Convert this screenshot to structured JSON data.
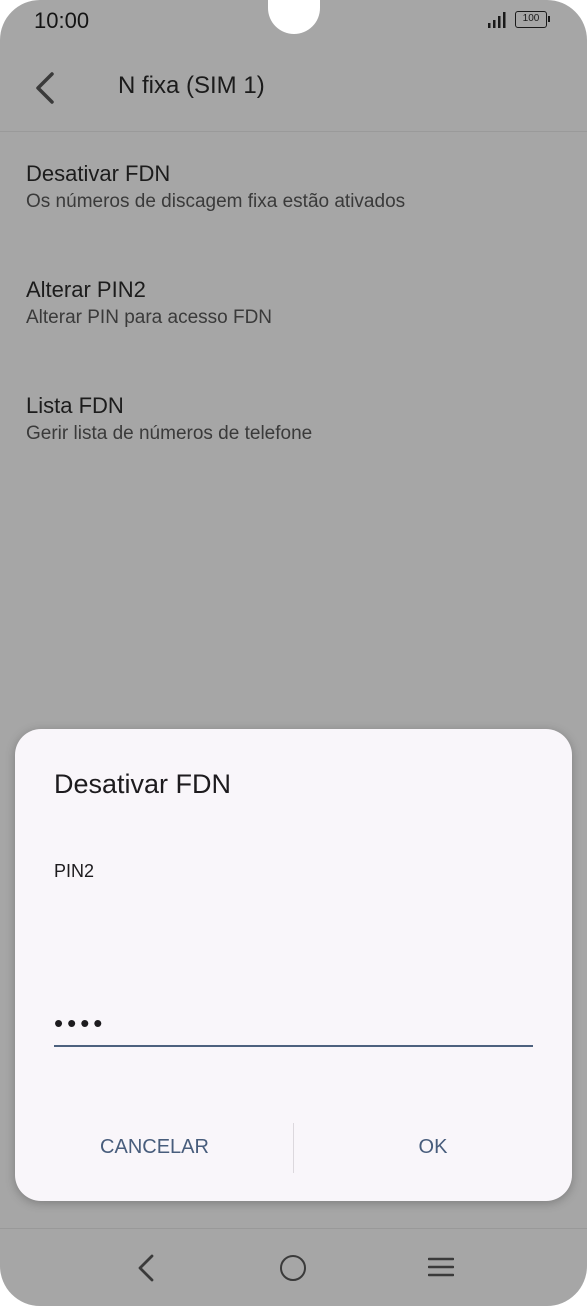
{
  "status_bar": {
    "time": "10:00",
    "battery": "100",
    "icons": [
      "signal-icon",
      "battery-icon"
    ]
  },
  "app_bar": {
    "title": "N fixa (SIM 1)",
    "back_icon": "back-arrow-icon"
  },
  "settings": [
    {
      "title": "Desativar FDN",
      "subtitle": "Os números de discagem fixa estão ativados"
    },
    {
      "title": "Alterar PIN2",
      "subtitle": "Alterar PIN para acesso FDN"
    },
    {
      "title": "Lista FDN",
      "subtitle": "Gerir lista de números de telefone"
    }
  ],
  "dialog": {
    "title": "Desativar FDN",
    "field_label": "PIN2",
    "field_value": "••••",
    "cancel_label": "CANCELAR",
    "ok_label": "OK"
  },
  "nav_bar": {
    "icons": [
      "nav-back-icon",
      "nav-home-icon",
      "nav-menu-icon"
    ]
  },
  "colors": {
    "scrim_background": "#a6a6a6",
    "dialog_background": "#f9f6fa",
    "accent": "#485d7c"
  }
}
